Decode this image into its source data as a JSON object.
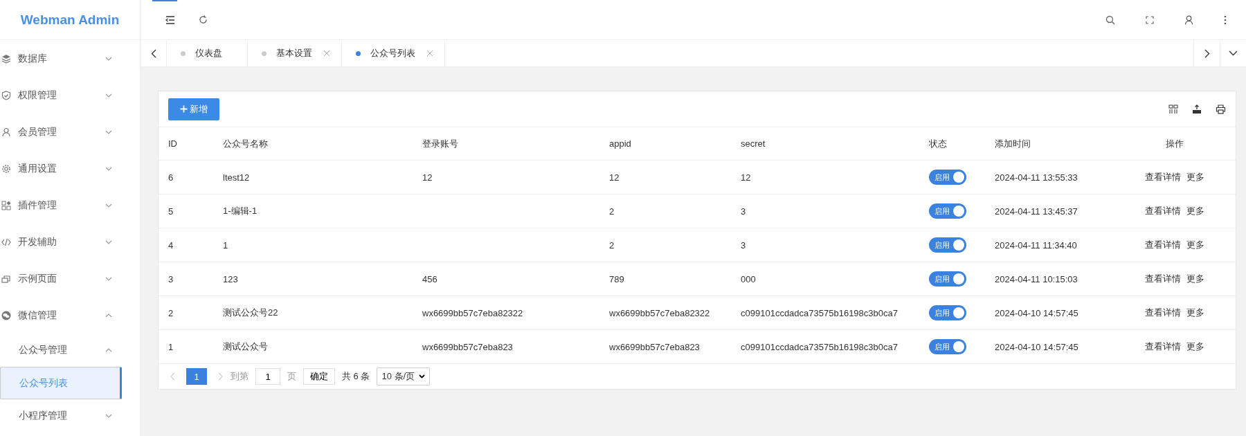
{
  "sidebar": {
    "logo": "Webman Admin",
    "items": [
      {
        "label": "数据库",
        "expanded": false
      },
      {
        "label": "权限管理",
        "expanded": false
      },
      {
        "label": "会员管理",
        "expanded": false
      },
      {
        "label": "通用设置",
        "expanded": false
      },
      {
        "label": "插件管理",
        "expanded": false
      },
      {
        "label": "开发辅助",
        "expanded": false
      },
      {
        "label": "示例页面",
        "expanded": false
      },
      {
        "label": "微信管理",
        "expanded": true,
        "children": [
          {
            "label": "公众号管理",
            "expanded": true,
            "children": [
              {
                "label": "公众号列表",
                "selected": true
              }
            ]
          },
          {
            "label": "小程序管理",
            "expanded": false
          }
        ]
      }
    ]
  },
  "tabs": [
    {
      "label": "仪表盘",
      "selected": false,
      "closable": false
    },
    {
      "label": "基本设置",
      "selected": false,
      "closable": true
    },
    {
      "label": "公众号列表",
      "selected": true,
      "closable": true
    }
  ],
  "toolbar": {
    "add_button": "新增"
  },
  "table": {
    "columns": [
      "ID",
      "公众号名称",
      "登录账号",
      "appid",
      "secret",
      "状态",
      "添加时间",
      "操作"
    ],
    "rows": [
      {
        "id": "6",
        "name": "ltest12",
        "login": "12",
        "appid": "12",
        "secret": "12",
        "status": {
          "on": true,
          "label": "启用"
        },
        "added": "2024-04-11 13:55:33",
        "actions": [
          "查看详情",
          "更多"
        ]
      },
      {
        "id": "5",
        "name": "1-编辑-1",
        "login": "",
        "appid": "2",
        "secret": "3",
        "status": {
          "on": true,
          "label": "启用"
        },
        "added": "2024-04-11 13:45:37",
        "actions": [
          "查看详情",
          "更多"
        ]
      },
      {
        "id": "4",
        "name": "1",
        "login": "",
        "appid": "2",
        "secret": "3",
        "status": {
          "on": true,
          "label": "启用"
        },
        "added": "2024-04-11 11:34:40",
        "actions": [
          "查看详情",
          "更多"
        ]
      },
      {
        "id": "3",
        "name": "123",
        "login": "456",
        "appid": "789",
        "secret": "000",
        "status": {
          "on": true,
          "label": "启用"
        },
        "added": "2024-04-11 10:15:03",
        "actions": [
          "查看详情",
          "更多"
        ]
      },
      {
        "id": "2",
        "name": "测试公众号22",
        "login": "wx6699bb57c7eba82322",
        "appid": "wx6699bb57c7eba82322",
        "secret": "c099101ccdadca73575b16198c3b0ca7",
        "status": {
          "on": true,
          "label": "启用"
        },
        "added": "2024-04-10 14:57:45",
        "actions": [
          "查看详情",
          "更多"
        ]
      },
      {
        "id": "1",
        "name": "测试公众号",
        "login": "wx6699bb57c7eba823",
        "appid": "wx6699bb57c7eba823",
        "secret": "c099101ccdadca73575b16198c3b0ca7",
        "status": {
          "on": true,
          "label": "启用"
        },
        "added": "2024-04-10 14:57:45",
        "actions": [
          "查看详情",
          "更多"
        ]
      }
    ]
  },
  "pagination": {
    "current_page": "1",
    "goto_label": "到第",
    "goto_value": "1",
    "page_unit": "页",
    "confirm": "确定",
    "total": "共 6 条",
    "page_size": "10 条/页"
  }
}
